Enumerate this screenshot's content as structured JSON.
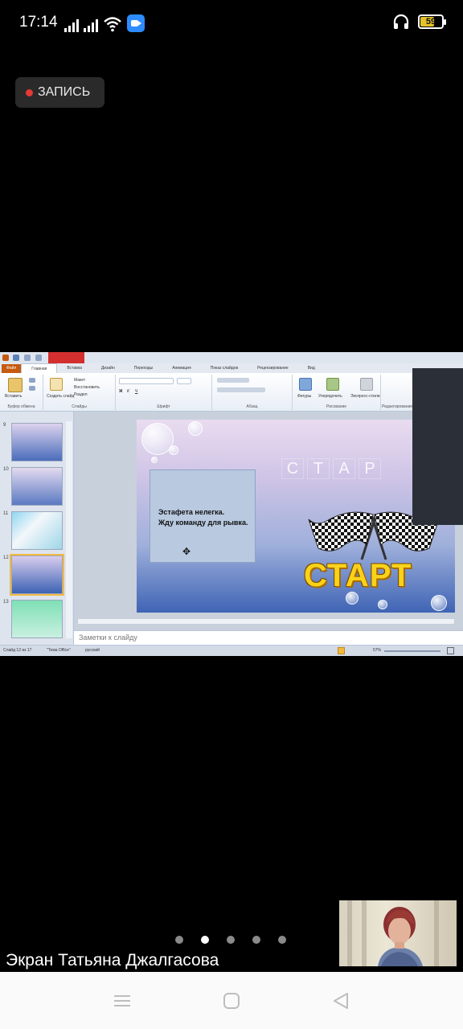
{
  "status_bar": {
    "time": "17:14",
    "battery": "59",
    "battery_level": 0.59
  },
  "recording": {
    "label": "ЗАПИСЬ",
    "dot_color": "#E53935"
  },
  "shared_screen": {
    "app": "PowerPoint",
    "ribbon_tabs": [
      "Файл",
      "Главная",
      "Вставка",
      "Дизайн",
      "Переходы",
      "Анимация",
      "Показ слайдов",
      "Рецензирование",
      "Вид"
    ],
    "active_tab": "Главная",
    "ribbon_groups": [
      "Буфер обмена",
      "Слайды",
      "Шрифт",
      "Абзац",
      "Рисование",
      "Редактирование"
    ],
    "ribbon_buttons": {
      "paste": "Вставить",
      "new_slide": "Создать слайд",
      "layout": "Макет",
      "reset": "Восстановить",
      "section": "Раздел",
      "shapes": "Фигуры",
      "arrange": "Упорядочить",
      "quick_styles": "Экспресс-стили"
    },
    "thumbnails": [
      {
        "number": "9"
      },
      {
        "number": "10"
      },
      {
        "number": "11"
      },
      {
        "number": "12",
        "selected": true
      },
      {
        "number": "13"
      }
    ],
    "slide": {
      "text_line1": "Эстафета нелегка.",
      "text_line2": "Жду команду для рывка.",
      "letters": [
        "С",
        "Т",
        "А",
        "Р"
      ],
      "start_word": "СТАРТ"
    },
    "notes_placeholder": "Заметки к слайду",
    "status": {
      "slide_counter": "Слайд 12 из 17",
      "theme": "\"Тема Office\"",
      "language": "русский",
      "zoom": "57%"
    }
  },
  "pager": {
    "count": 5,
    "active_index": 1
  },
  "speaker": {
    "name": "Экран Татьяна Джалгасова"
  },
  "icons": {
    "signal": "signal-icon",
    "wifi": "wifi-icon",
    "zoom": "zoom-app-icon",
    "headphones": "headphones-icon",
    "battery": "battery-icon",
    "menu": "recent-apps-icon",
    "home": "home-icon",
    "back": "back-icon"
  }
}
